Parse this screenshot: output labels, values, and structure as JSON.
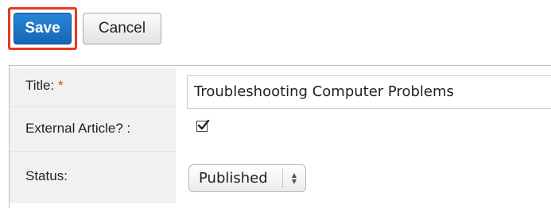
{
  "toolbar": {
    "save_label": "Save",
    "cancel_label": "Cancel"
  },
  "form": {
    "title_label": "Title:",
    "title_required_marker": "*",
    "title_value": "Troubleshooting Computer Problems",
    "external_label": "External Article? :",
    "external_checked": true,
    "status_label": "Status:",
    "status_value": "Published"
  },
  "colors": {
    "save_button": "#1a73c9",
    "highlight_border": "#e8391d",
    "required_marker": "#e8391d",
    "label_background": "#f1f1f1"
  },
  "icons": {
    "checkbox": "checkmark-icon",
    "select_arrows": "updown-arrows-icon"
  }
}
